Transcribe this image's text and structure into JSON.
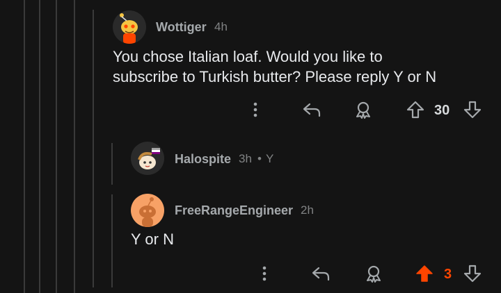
{
  "comments": [
    {
      "username": "Wottiger",
      "time": "4h",
      "body_line1": "You chose Italian loaf. Would you like to",
      "body_line2": "subscribe to Turkish butter? Please reply Y or N",
      "score": "30",
      "avatar_icon": "snoo-avatar-yellow-icon"
    },
    {
      "username": "Halospite",
      "time": "3h",
      "separator": "•",
      "flair": "Y",
      "avatar_icon": "snoo-avatar-white-icon"
    },
    {
      "username": "FreeRangeEngineer",
      "time": "2h",
      "body": "Y or N",
      "score": "3",
      "avatar_icon": "default-snoo-avatar-icon"
    }
  ],
  "colors": {
    "background": "#141414",
    "upvoted": "#ff4500",
    "text": "#e8eaed",
    "muted": "#818384",
    "thread_line": "#3a3a3a"
  },
  "icons": [
    "more-options-icon",
    "reply-icon",
    "award-icon",
    "upvote-icon",
    "downvote-icon"
  ]
}
